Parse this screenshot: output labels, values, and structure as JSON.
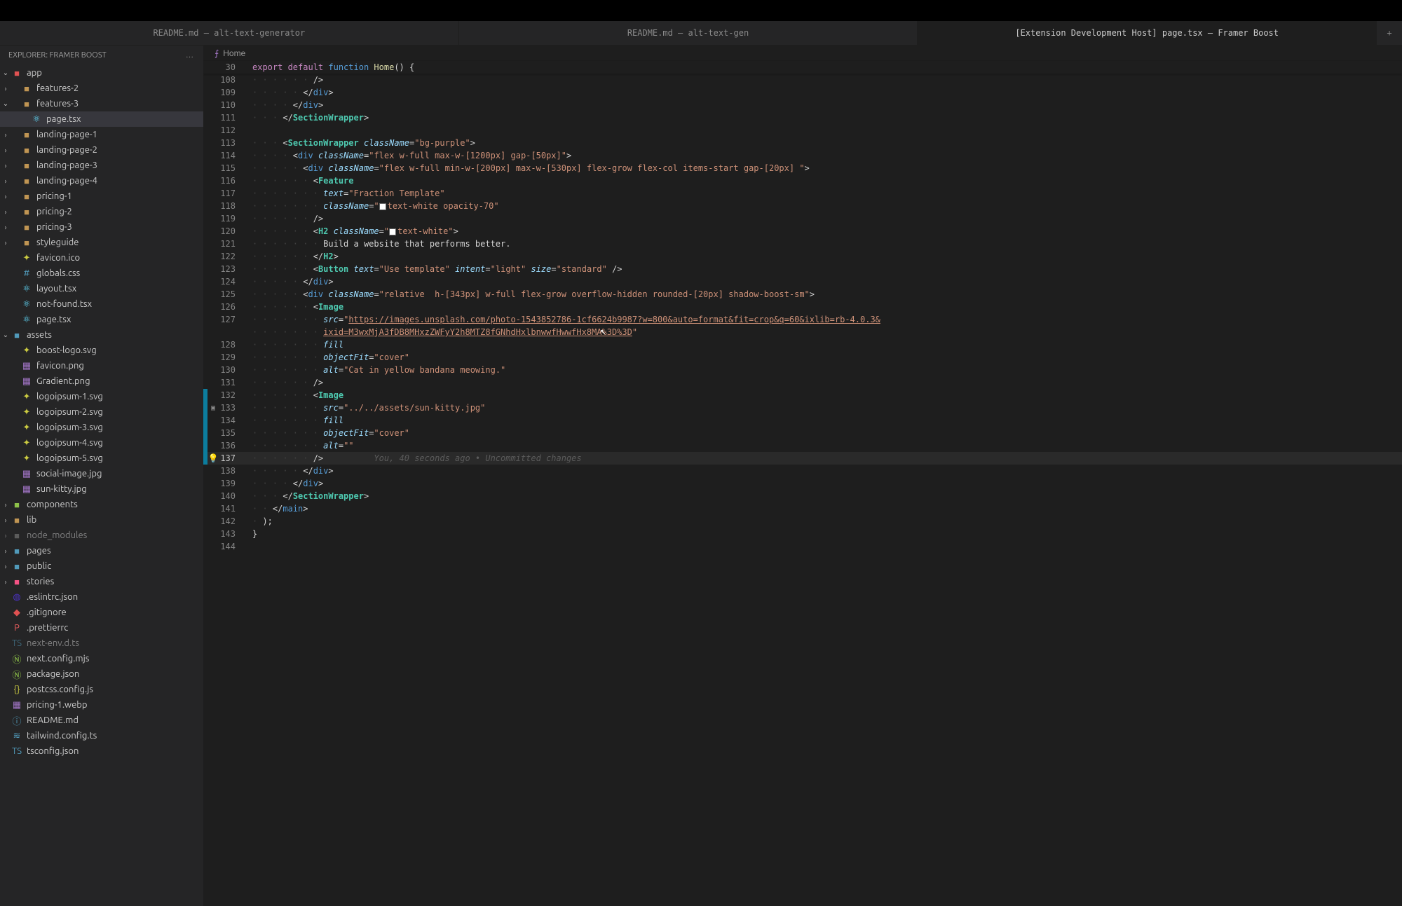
{
  "tabs": [
    {
      "label": "README.md — alt-text-generator",
      "active": false
    },
    {
      "label": "README.md — alt-text-gen",
      "active": false
    },
    {
      "label": "[Extension Development Host] page.tsx — Framer Boost",
      "active": true
    }
  ],
  "explorer": {
    "title": "Explorer: Framer Boost",
    "more": "…"
  },
  "tree": [
    {
      "depth": 0,
      "twisty": "down",
      "icon": "folder-app",
      "label": "app"
    },
    {
      "depth": 1,
      "twisty": "right",
      "icon": "folder",
      "label": "features-2"
    },
    {
      "depth": 1,
      "twisty": "down",
      "icon": "folder",
      "label": "features-3"
    },
    {
      "depth": 2,
      "twisty": "",
      "icon": "react",
      "label": "page.tsx",
      "selected": true
    },
    {
      "depth": 1,
      "twisty": "right",
      "icon": "folder",
      "label": "landing-page-1"
    },
    {
      "depth": 1,
      "twisty": "right",
      "icon": "folder",
      "label": "landing-page-2"
    },
    {
      "depth": 1,
      "twisty": "right",
      "icon": "folder",
      "label": "landing-page-3"
    },
    {
      "depth": 1,
      "twisty": "right",
      "icon": "folder",
      "label": "landing-page-4"
    },
    {
      "depth": 1,
      "twisty": "right",
      "icon": "folder",
      "label": "pricing-1"
    },
    {
      "depth": 1,
      "twisty": "right",
      "icon": "folder",
      "label": "pricing-2"
    },
    {
      "depth": 1,
      "twisty": "right",
      "icon": "folder",
      "label": "pricing-3"
    },
    {
      "depth": 1,
      "twisty": "right",
      "icon": "folder",
      "label": "styleguide"
    },
    {
      "depth": 1,
      "twisty": "",
      "icon": "star",
      "label": "favicon.ico"
    },
    {
      "depth": 1,
      "twisty": "",
      "icon": "css",
      "label": "globals.css"
    },
    {
      "depth": 1,
      "twisty": "",
      "icon": "react",
      "label": "layout.tsx"
    },
    {
      "depth": 1,
      "twisty": "",
      "icon": "react",
      "label": "not-found.tsx"
    },
    {
      "depth": 1,
      "twisty": "",
      "icon": "react",
      "label": "page.tsx"
    },
    {
      "depth": 0,
      "twisty": "down",
      "icon": "folder-teal",
      "label": "assets"
    },
    {
      "depth": 1,
      "twisty": "",
      "icon": "star",
      "label": "boost-logo.svg"
    },
    {
      "depth": 1,
      "twisty": "",
      "icon": "img",
      "label": "favicon.png"
    },
    {
      "depth": 1,
      "twisty": "",
      "icon": "img",
      "label": "Gradient.png"
    },
    {
      "depth": 1,
      "twisty": "",
      "icon": "star",
      "label": "logoipsum-1.svg"
    },
    {
      "depth": 1,
      "twisty": "",
      "icon": "star",
      "label": "logoipsum-2.svg"
    },
    {
      "depth": 1,
      "twisty": "",
      "icon": "star",
      "label": "logoipsum-3.svg"
    },
    {
      "depth": 1,
      "twisty": "",
      "icon": "star",
      "label": "logoipsum-4.svg"
    },
    {
      "depth": 1,
      "twisty": "",
      "icon": "star",
      "label": "logoipsum-5.svg"
    },
    {
      "depth": 1,
      "twisty": "",
      "icon": "img",
      "label": "social-image.jpg"
    },
    {
      "depth": 1,
      "twisty": "",
      "icon": "img",
      "label": "sun-kitty.jpg"
    },
    {
      "depth": 0,
      "twisty": "right",
      "icon": "folder-green",
      "label": "components"
    },
    {
      "depth": 0,
      "twisty": "right",
      "icon": "folder",
      "label": "lib"
    },
    {
      "depth": 0,
      "twisty": "right",
      "icon": "folder-gray",
      "label": "node_modules",
      "dim": true
    },
    {
      "depth": 0,
      "twisty": "right",
      "icon": "folder-teal",
      "label": "pages"
    },
    {
      "depth": 0,
      "twisty": "right",
      "icon": "folder-teal",
      "label": "public"
    },
    {
      "depth": 0,
      "twisty": "right",
      "icon": "folder-pink",
      "label": "stories"
    },
    {
      "depth": 0,
      "twisty": "",
      "icon": "eslint",
      "label": ".eslintrc.json"
    },
    {
      "depth": 0,
      "twisty": "",
      "icon": "git",
      "label": ".gitignore"
    },
    {
      "depth": 0,
      "twisty": "",
      "icon": "prettier",
      "label": ".prettierrc"
    },
    {
      "depth": 0,
      "twisty": "",
      "icon": "ts",
      "label": "next-env.d.ts",
      "dim": true
    },
    {
      "depth": 0,
      "twisty": "",
      "icon": "node",
      "label": "next.config.mjs"
    },
    {
      "depth": 0,
      "twisty": "",
      "icon": "node",
      "label": "package.json"
    },
    {
      "depth": 0,
      "twisty": "",
      "icon": "json",
      "label": "postcss.config.js"
    },
    {
      "depth": 0,
      "twisty": "",
      "icon": "webp",
      "label": "pricing-1.webp"
    },
    {
      "depth": 0,
      "twisty": "",
      "icon": "info",
      "label": "README.md"
    },
    {
      "depth": 0,
      "twisty": "",
      "icon": "tailwind",
      "label": "tailwind.config.ts"
    },
    {
      "depth": 0,
      "twisty": "",
      "icon": "ts",
      "label": "tsconfig.json"
    }
  ],
  "breadcrumb": {
    "symbol": "⨍",
    "name": "Home"
  },
  "sticky": {
    "num": "30",
    "tokens": [
      {
        "t": "export ",
        "c": "kw-export"
      },
      {
        "t": "default ",
        "c": "kw-default"
      },
      {
        "t": "function ",
        "c": "kw-function"
      },
      {
        "t": "Home",
        "c": "fn-name"
      },
      {
        "t": "() {",
        "c": "punc"
      }
    ]
  },
  "lines": [
    {
      "n": 108,
      "ind": 12,
      "tokens": [
        {
          "t": "/>",
          "c": "punc"
        }
      ]
    },
    {
      "n": 109,
      "ind": 10,
      "tokens": [
        {
          "t": "</",
          "c": "punc"
        },
        {
          "t": "div",
          "c": "tag-html"
        },
        {
          "t": ">",
          "c": "punc"
        }
      ]
    },
    {
      "n": 110,
      "ind": 8,
      "tokens": [
        {
          "t": "</",
          "c": "punc"
        },
        {
          "t": "div",
          "c": "tag-html"
        },
        {
          "t": ">",
          "c": "punc"
        }
      ]
    },
    {
      "n": 111,
      "ind": 6,
      "tokens": [
        {
          "t": "</",
          "c": "punc"
        },
        {
          "t": "SectionWrapper",
          "c": "comp"
        },
        {
          "t": ">",
          "c": "punc"
        }
      ]
    },
    {
      "n": 112,
      "ind": 0,
      "tokens": []
    },
    {
      "n": 113,
      "ind": 6,
      "tokens": [
        {
          "t": "<",
          "c": "punc"
        },
        {
          "t": "SectionWrapper",
          "c": "comp"
        },
        {
          "t": " ",
          "c": ""
        },
        {
          "t": "className",
          "c": "attr"
        },
        {
          "t": "=",
          "c": "punc"
        },
        {
          "t": "\"bg-purple\"",
          "c": "str"
        },
        {
          "t": ">",
          "c": "punc"
        }
      ]
    },
    {
      "n": 114,
      "ind": 8,
      "tokens": [
        {
          "t": "<",
          "c": "punc"
        },
        {
          "t": "div",
          "c": "tag-html"
        },
        {
          "t": " ",
          "c": ""
        },
        {
          "t": "className",
          "c": "attr"
        },
        {
          "t": "=",
          "c": "punc"
        },
        {
          "t": "\"flex w-full max-w-[1200px] gap-[50px]\"",
          "c": "str"
        },
        {
          "t": ">",
          "c": "punc"
        }
      ]
    },
    {
      "n": 115,
      "ind": 10,
      "tokens": [
        {
          "t": "<",
          "c": "punc"
        },
        {
          "t": "div",
          "c": "tag-html"
        },
        {
          "t": " ",
          "c": ""
        },
        {
          "t": "className",
          "c": "attr"
        },
        {
          "t": "=",
          "c": "punc"
        },
        {
          "t": "\"flex w-full min-w-[200px] max-w-[530px] flex-grow flex-col items-start gap-[20px] \"",
          "c": "str"
        },
        {
          "t": ">",
          "c": "punc"
        }
      ]
    },
    {
      "n": 116,
      "ind": 12,
      "tokens": [
        {
          "t": "<",
          "c": "punc"
        },
        {
          "t": "Feature",
          "c": "comp"
        }
      ]
    },
    {
      "n": 117,
      "ind": 14,
      "tokens": [
        {
          "t": "text",
          "c": "attr"
        },
        {
          "t": "=",
          "c": "punc"
        },
        {
          "t": "\"Fraction Template\"",
          "c": "str"
        }
      ]
    },
    {
      "n": 118,
      "ind": 14,
      "tokens": [
        {
          "t": "className",
          "c": "attr"
        },
        {
          "t": "=",
          "c": "punc"
        },
        {
          "t": "\"",
          "c": "str"
        },
        {
          "t": "",
          "c": "",
          "box": "#ffffff"
        },
        {
          "t": "text-white opacity-70\"",
          "c": "str"
        }
      ]
    },
    {
      "n": 119,
      "ind": 12,
      "tokens": [
        {
          "t": "/>",
          "c": "punc"
        }
      ]
    },
    {
      "n": 120,
      "ind": 12,
      "tokens": [
        {
          "t": "<",
          "c": "punc"
        },
        {
          "t": "H2",
          "c": "comp"
        },
        {
          "t": " ",
          "c": ""
        },
        {
          "t": "className",
          "c": "attr"
        },
        {
          "t": "=",
          "c": "punc"
        },
        {
          "t": "\"",
          "c": "str"
        },
        {
          "t": "",
          "c": "",
          "box": "#ffffff"
        },
        {
          "t": "text-white\"",
          "c": "str"
        },
        {
          "t": ">",
          "c": "punc"
        }
      ]
    },
    {
      "n": 121,
      "ind": 14,
      "tokens": [
        {
          "t": "Build a website that performs better.",
          "c": "txt"
        }
      ]
    },
    {
      "n": 122,
      "ind": 12,
      "tokens": [
        {
          "t": "</",
          "c": "punc"
        },
        {
          "t": "H2",
          "c": "comp"
        },
        {
          "t": ">",
          "c": "punc"
        }
      ]
    },
    {
      "n": 123,
      "ind": 12,
      "tokens": [
        {
          "t": "<",
          "c": "punc"
        },
        {
          "t": "Button",
          "c": "comp"
        },
        {
          "t": " ",
          "c": ""
        },
        {
          "t": "text",
          "c": "attr"
        },
        {
          "t": "=",
          "c": "punc"
        },
        {
          "t": "\"Use template\"",
          "c": "str"
        },
        {
          "t": " ",
          "c": ""
        },
        {
          "t": "intent",
          "c": "attr"
        },
        {
          "t": "=",
          "c": "punc"
        },
        {
          "t": "\"light\"",
          "c": "str"
        },
        {
          "t": " ",
          "c": ""
        },
        {
          "t": "size",
          "c": "attr"
        },
        {
          "t": "=",
          "c": "punc"
        },
        {
          "t": "\"standard\"",
          "c": "str"
        },
        {
          "t": " />",
          "c": "punc"
        }
      ]
    },
    {
      "n": 124,
      "ind": 10,
      "tokens": [
        {
          "t": "</",
          "c": "punc"
        },
        {
          "t": "div",
          "c": "tag-html"
        },
        {
          "t": ">",
          "c": "punc"
        }
      ]
    },
    {
      "n": 125,
      "ind": 10,
      "tokens": [
        {
          "t": "<",
          "c": "punc"
        },
        {
          "t": "div",
          "c": "tag-html"
        },
        {
          "t": " ",
          "c": ""
        },
        {
          "t": "className",
          "c": "attr"
        },
        {
          "t": "=",
          "c": "punc"
        },
        {
          "t": "\"relative  h-[343px] w-full flex-grow overflow-hidden rounded-[20px] shadow-boost-sm\"",
          "c": "str"
        },
        {
          "t": ">",
          "c": "punc"
        }
      ]
    },
    {
      "n": 126,
      "ind": 12,
      "tokens": [
        {
          "t": "<",
          "c": "punc"
        },
        {
          "t": "Image",
          "c": "comp"
        }
      ]
    },
    {
      "n": 127,
      "ind": 14,
      "tokens": [
        {
          "t": "src",
          "c": "attr"
        },
        {
          "t": "=",
          "c": "punc"
        },
        {
          "t": "\"",
          "c": "str"
        },
        {
          "t": "https://images.unsplash.com/photo-1543852786-1cf6624b9987?w=800&auto=format&fit=crop&q=60&ixlib=rb-4.0.3&",
          "c": "str-link"
        }
      ]
    },
    {
      "n": "127b",
      "ind": 14,
      "tokens": [
        {
          "t": "ixid=M3wxMjA3fDB8MHxzZWFyY2h8MTZ8fGNhdHxlbnwwfHwwfHx8MA%3D%3D",
          "c": "str-link"
        },
        {
          "t": "\"",
          "c": "str"
        }
      ],
      "nonum": true
    },
    {
      "n": 128,
      "ind": 14,
      "tokens": [
        {
          "t": "fill",
          "c": "attr"
        }
      ]
    },
    {
      "n": 129,
      "ind": 14,
      "tokens": [
        {
          "t": "objectFit",
          "c": "attr"
        },
        {
          "t": "=",
          "c": "punc"
        },
        {
          "t": "\"cover\"",
          "c": "str"
        }
      ]
    },
    {
      "n": 130,
      "ind": 14,
      "tokens": [
        {
          "t": "alt",
          "c": "attr"
        },
        {
          "t": "=",
          "c": "punc"
        },
        {
          "t": "\"Cat in yellow bandana meowing.\"",
          "c": "str"
        }
      ]
    },
    {
      "n": 131,
      "ind": 12,
      "tokens": [
        {
          "t": "/>",
          "c": "punc"
        }
      ]
    },
    {
      "n": 132,
      "ind": 12,
      "mark": "mod",
      "tokens": [
        {
          "t": "<",
          "c": "punc"
        },
        {
          "t": "Image",
          "c": "comp"
        }
      ]
    },
    {
      "n": 133,
      "ind": 14,
      "mark": "mod",
      "deco": "▣",
      "tokens": [
        {
          "t": "src",
          "c": "attr"
        },
        {
          "t": "=",
          "c": "punc"
        },
        {
          "t": "\"../../assets/sun-kitty.jpg\"",
          "c": "str"
        }
      ]
    },
    {
      "n": 134,
      "ind": 14,
      "mark": "mod",
      "tokens": [
        {
          "t": "fill",
          "c": "attr"
        }
      ]
    },
    {
      "n": 135,
      "ind": 14,
      "mark": "mod",
      "tokens": [
        {
          "t": "objectFit",
          "c": "attr"
        },
        {
          "t": "=",
          "c": "punc"
        },
        {
          "t": "\"cover\"",
          "c": "str"
        }
      ]
    },
    {
      "n": 136,
      "ind": 14,
      "mark": "mod",
      "tokens": [
        {
          "t": "alt",
          "c": "attr"
        },
        {
          "t": "=",
          "c": "punc"
        },
        {
          "t": "\"\"",
          "c": "str"
        }
      ]
    },
    {
      "n": 137,
      "ind": 12,
      "mark": "mod",
      "active": true,
      "bulb": true,
      "tokens": [
        {
          "t": "/>",
          "c": "punc"
        },
        {
          "t": "          ",
          "c": ""
        },
        {
          "t": "You, 40 seconds ago • Uncommitted changes",
          "c": "blame"
        }
      ]
    },
    {
      "n": 138,
      "ind": 10,
      "tokens": [
        {
          "t": "</",
          "c": "punc"
        },
        {
          "t": "div",
          "c": "tag-html"
        },
        {
          "t": ">",
          "c": "punc"
        }
      ]
    },
    {
      "n": 139,
      "ind": 8,
      "tokens": [
        {
          "t": "</",
          "c": "punc"
        },
        {
          "t": "div",
          "c": "tag-html"
        },
        {
          "t": ">",
          "c": "punc"
        }
      ]
    },
    {
      "n": 140,
      "ind": 6,
      "tokens": [
        {
          "t": "</",
          "c": "punc"
        },
        {
          "t": "SectionWrapper",
          "c": "comp"
        },
        {
          "t": ">",
          "c": "punc"
        }
      ]
    },
    {
      "n": 141,
      "ind": 4,
      "tokens": [
        {
          "t": "</",
          "c": "punc"
        },
        {
          "t": "main",
          "c": "tag-html"
        },
        {
          "t": ">",
          "c": "punc"
        }
      ]
    },
    {
      "n": 142,
      "ind": 2,
      "tokens": [
        {
          "t": ");",
          "c": "punc"
        }
      ]
    },
    {
      "n": 143,
      "ind": 0,
      "tokens": [
        {
          "t": "}",
          "c": "punc"
        }
      ]
    },
    {
      "n": 144,
      "ind": 0,
      "tokens": []
    }
  ]
}
